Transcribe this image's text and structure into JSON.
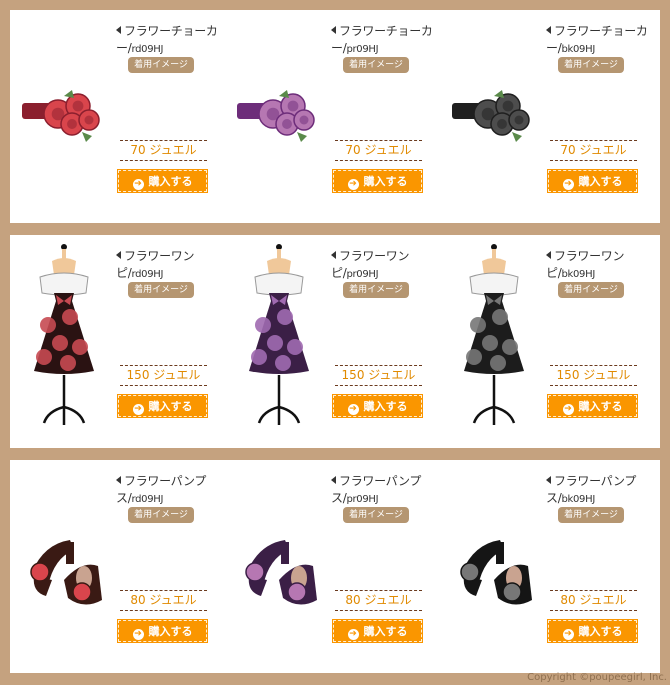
{
  "panels": [
    {
      "items": [
        {
          "name_line1": "フラワーチョーカ",
          "name_line2": "ー/",
          "code": "rd09HJ",
          "chaku": "着用イメージ",
          "price": "70 ジュエル",
          "buy": "購入する",
          "color": "#d9454c",
          "color_dark": "#8b1f2e",
          "icon": "flower-choker-red"
        },
        {
          "name_line1": "フラワーチョーカ",
          "name_line2": "ー/",
          "code": "pr09HJ",
          "chaku": "着用イメージ",
          "price": "70 ジュエル",
          "buy": "購入する",
          "color": "#b677b2",
          "color_dark": "#6d2d7a",
          "icon": "flower-choker-purple"
        },
        {
          "name_line1": "フラワーチョーカ",
          "name_line2": "ー/",
          "code": "bk09HJ",
          "chaku": "着用イメージ",
          "price": "70 ジュエル",
          "buy": "購入する",
          "color": "#4d4d4d",
          "color_dark": "#1f1f1f",
          "icon": "flower-choker-black"
        }
      ]
    },
    {
      "items": [
        {
          "name_line1": "フラワーワン",
          "name_line2": "ピ/",
          "code": "rd09HJ",
          "chaku": "着用イメージ",
          "price": "150 ジュエル",
          "buy": "購入する",
          "color": "#c74a52",
          "color_dark": "#2a1212",
          "icon": "flower-dress-red"
        },
        {
          "name_line1": "フラワーワン",
          "name_line2": "ピ/",
          "code": "pr09HJ",
          "chaku": "着用イメージ",
          "price": "150 ジュエル",
          "buy": "購入する",
          "color": "#a06ab0",
          "color_dark": "#3b1f46",
          "icon": "flower-dress-purple"
        },
        {
          "name_line1": "フラワーワン",
          "name_line2": "ピ/",
          "code": "bk09HJ",
          "chaku": "着用イメージ",
          "price": "150 ジュエル",
          "buy": "購入する",
          "color": "#777777",
          "color_dark": "#1c1c1c",
          "icon": "flower-dress-black"
        }
      ]
    },
    {
      "items": [
        {
          "name_line1": "フラワーパンプ",
          "name_line2": "ス/",
          "code": "rd09HJ",
          "chaku": "着用イメージ",
          "price": "80 ジュエル",
          "buy": "購入する",
          "color": "#d9454c",
          "color_dark": "#3a1a14",
          "icon": "flower-pumps-red"
        },
        {
          "name_line1": "フラワーパンプ",
          "name_line2": "ス/",
          "code": "pr09HJ",
          "chaku": "着用イメージ",
          "price": "80 ジュエル",
          "buy": "購入する",
          "color": "#b677b2",
          "color_dark": "#3b1f46",
          "icon": "flower-pumps-purple"
        },
        {
          "name_line1": "フラワーパンプ",
          "name_line2": "ス/",
          "code": "bk09HJ",
          "chaku": "着用イメージ",
          "price": "80 ジュエル",
          "buy": "購入する",
          "color": "#777777",
          "color_dark": "#151515",
          "icon": "flower-pumps-black"
        }
      ]
    }
  ],
  "copyright": "Copyright ©poupeegirl, Inc."
}
